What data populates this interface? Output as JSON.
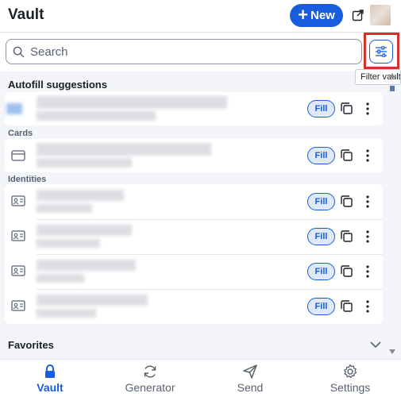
{
  "header": {
    "title": "Vault",
    "new_button_label": "New",
    "popout_icon": "popout-icon",
    "avatar": "account-avatar"
  },
  "search": {
    "placeholder": "Search",
    "value": "",
    "filter_button_icon": "sliders-icon",
    "filter_tooltip": "Filter vault"
  },
  "sections": {
    "autofill_title": "Autofill suggestions",
    "cards_label": "Cards",
    "identities_label": "Identities",
    "favorites_title": "Favorites"
  },
  "item_actions": {
    "fill_label": "Fill",
    "copy_icon": "copy-icon",
    "more_icon": "more-options-icon"
  },
  "nav": {
    "items": [
      {
        "label": "Vault",
        "icon": "lock-icon",
        "active": true
      },
      {
        "label": "Generator",
        "icon": "refresh-icon",
        "active": false
      },
      {
        "label": "Send",
        "icon": "send-icon",
        "active": false
      },
      {
        "label": "Settings",
        "icon": "gear-icon",
        "active": false
      }
    ]
  },
  "colors": {
    "accent": "#175ddc",
    "highlight": "#d5302c",
    "background": "#f3f5f9"
  }
}
